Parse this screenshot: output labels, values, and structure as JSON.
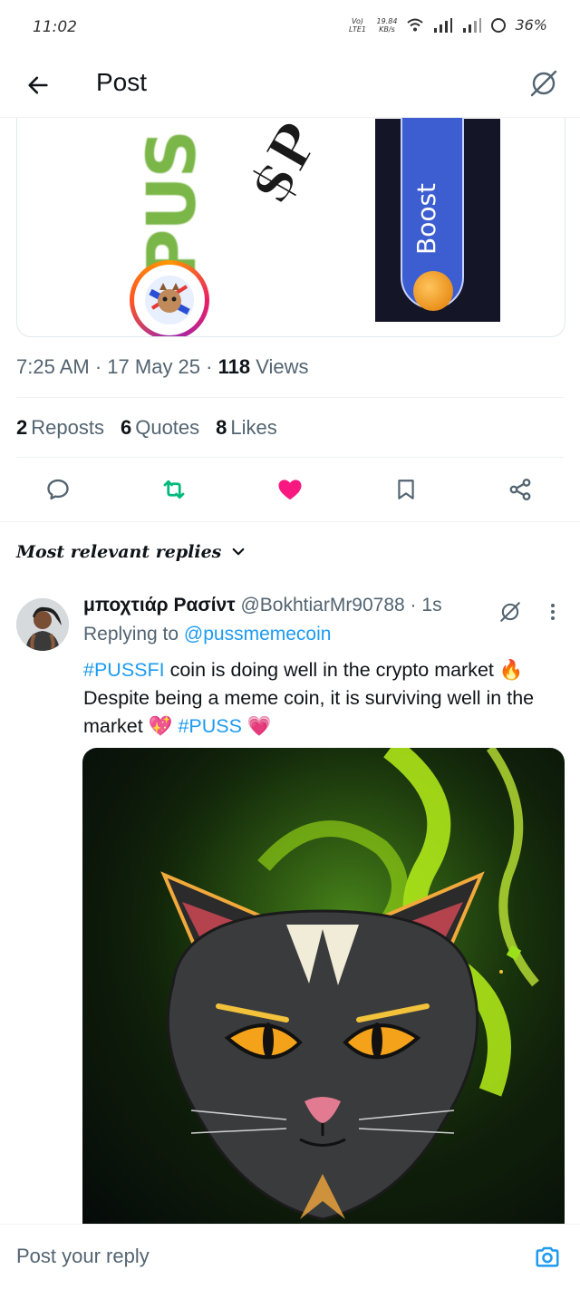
{
  "status_bar": {
    "time": "11:02",
    "net_line1": "Vo) LTE1",
    "speed_value": "19.84",
    "speed_unit": "KB/s",
    "battery": "36%"
  },
  "header": {
    "title": "Post",
    "back_icon": "arrow-left-icon",
    "grok_icon": "grok-icon"
  },
  "media": {
    "puss_text": "PUS",
    "boost_text": "Boost"
  },
  "post_meta": {
    "time": "7:25 AM",
    "date": "17 May 25",
    "views_count": "118",
    "views_label": "Views"
  },
  "stats": [
    {
      "count": "2",
      "label": "Reposts"
    },
    {
      "count": "6",
      "label": "Quotes"
    },
    {
      "count": "8",
      "label": "Likes"
    }
  ],
  "actions": {
    "reply_icon": "reply-icon",
    "repost_icon": "repost-icon",
    "like_icon": "heart-icon",
    "bookmark_icon": "bookmark-icon",
    "share_icon": "share-icon",
    "repost_color": "#00ba7c",
    "like_color": "#f91880"
  },
  "replies_filter": {
    "label": "Most relevant replies"
  },
  "reply": {
    "name": "μποχτιάρ Ρασίντ",
    "handle": "@BokhtiarMr90788",
    "sep": " · ",
    "time": "1s",
    "replying_to_label": "Replying to ",
    "replying_to_handle": "@pussmemecoin",
    "text_hashtag1": "#PUSSFI",
    "text_part1": " coin is doing well in the crypto market 🔥 Despite being a meme coin, it is surviving well in the market 💖 ",
    "text_hashtag2": "#PUSS",
    "text_part2": " 💗"
  },
  "composer": {
    "placeholder": "Post your reply",
    "camera_icon": "camera-icon"
  },
  "colors": {
    "link": "#1d9bf0",
    "text": "#0f1419",
    "muted": "#536471"
  }
}
